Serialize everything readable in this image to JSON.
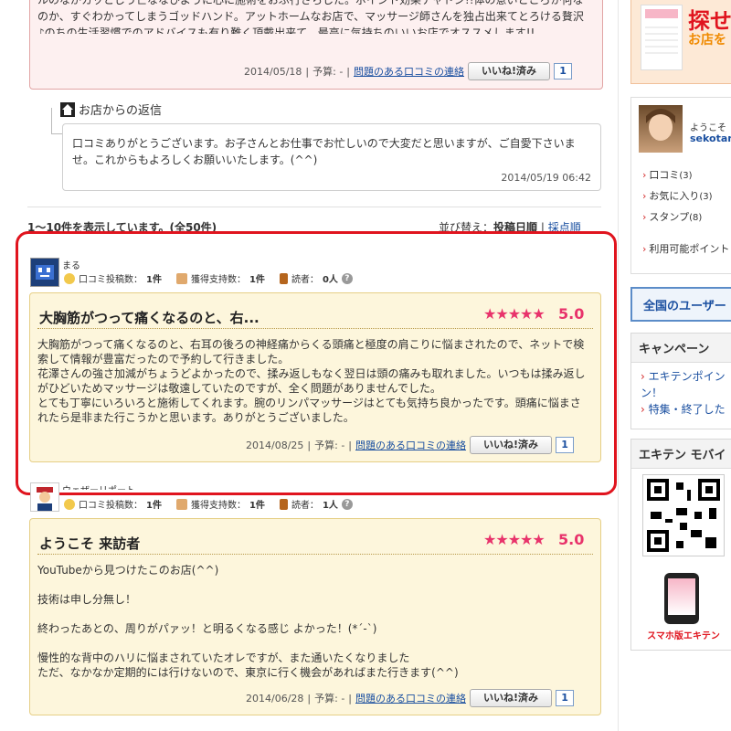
{
  "top_review": {
    "text_line1": "ルのながカッとじう亡ななひように心に施術をおぶ行さらした。ボイント効果チャドン!!体の意いところか何なのか、すぐわかってしまうゴッドハンド。アットホームなお店で、マッサージ師さんを独占出来てとろける贅沢♪のちの生活習慣でのアドバイスも有り難く頂戴出来て、最高に気持ちのいいお店でオススメします!!",
    "date": "2014/05/18",
    "budget": "予算: -",
    "report_link": "問題のある口コミの連絡",
    "like_label": "いいね!済み",
    "like_count": "1"
  },
  "shop_reply": {
    "heading": "お店からの返信",
    "text": "口コミありがとうございます。お子さんとお仕事でお忙しいので大変だと思いますが、ご自愛下さいませ。これからもよろしくお願いいたします。(^^)",
    "datetime": "2014/05/19 06:42"
  },
  "list_header": {
    "count_text": "1～10件を表示しています。(全50件)",
    "sort_label": "並び替え：",
    "sort_current": "投稿日順",
    "sort_alt": "採点順"
  },
  "reviews": [
    {
      "user": "まる",
      "posts_label": "口コミ投稿数：",
      "posts": "1件",
      "support_label": "獲得支持数：",
      "support": "1件",
      "readers_label": "読者：",
      "readers": "0人",
      "title": "大胸筋がつって痛くなるのと、右...",
      "stars": "★★★★★",
      "score": "5.0",
      "body": "大胸筋がつって痛くなるのと、右耳の後ろの神経痛からくる頭痛と極度の肩こりに悩まされたので、ネットで検索して情報が豊富だったので予約して行きました。\n花澤さんの強さ加減がちょうどよかったので、揉み返しもなく翌日は頭の痛みも取れました。いつもは揉み返しがひどいためマッサージは敬遠していたのですが、全く問題がありませんでした。\nとても丁寧にいろいろと施術してくれます。腕のリンパマッサージはとても気持ち良かったです。頭痛に悩まされたら是非また行こうかと思います。ありがとうございました。",
      "date": "2014/08/25",
      "budget": "予算: -",
      "report_link": "問題のある口コミの連絡",
      "like_label": "いいね!済み",
      "like_count": "1"
    },
    {
      "user": "ウェザーリポート",
      "posts_label": "口コミ投稿数：",
      "posts": "1件",
      "support_label": "獲得支持数：",
      "support": "1件",
      "readers_label": "読者：",
      "readers": "1人",
      "title": "ようこそ 来訪者",
      "stars": "★★★★★",
      "score": "5.0",
      "body": "YouTubeから見つけたこのお店(^^)\n\n技術は申し分無し！\n\n終わったあとの、周りがパァッ！と明るくなる感じ よかった！(*´-`)\n\n慢性的な背中のハリに悩まされていたオレですが、また通いたくなりました\nただ、なかなか定期的には行けないので、東京に行く機会があればまた行きます(^^)",
      "date": "2014/06/28",
      "budget": "予算: -",
      "report_link": "問題のある口コミの連絡",
      "like_label": "いいね!済み",
      "like_count": "1"
    }
  ],
  "sidebar": {
    "banner_text_big": "探せ",
    "banner_text_small": "お店を",
    "welcome": "ようこそ",
    "username": "sekotan",
    "menu": [
      {
        "label": "口コミ",
        "count": "(3)"
      },
      {
        "label": "お気に入り",
        "count": "(3)"
      },
      {
        "label": "スタンプ",
        "count": "(8)"
      },
      {
        "label": "利用可能ポイント",
        "count": ""
      }
    ],
    "users_heading": "全国のユーザー",
    "campaign_heading": "キャンペーン",
    "campaign_links": [
      "エキテンポイン",
      "ン！",
      "特集・終了した"
    ],
    "mobile_heading": "エキテン モバイ",
    "smartphone_label": "スマホ版エキテン"
  },
  "colors": {
    "accent_red": "#e0141e",
    "star_pink": "#e8336b",
    "link_blue": "#1a4fa0"
  }
}
